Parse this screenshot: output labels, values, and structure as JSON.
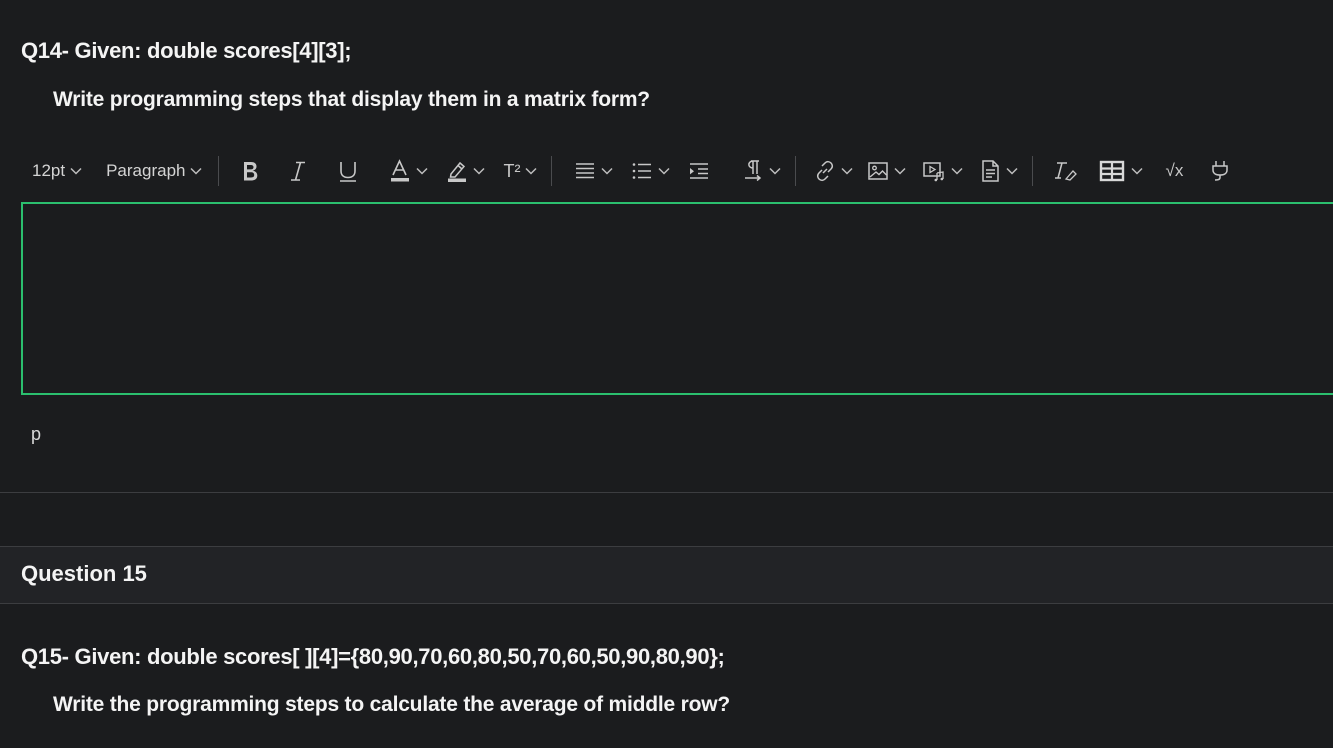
{
  "question14": {
    "title": "Q14- Given: double scores[4][3];",
    "prompt": "Write programming steps that display them in a matrix form?"
  },
  "toolbar": {
    "font_size": "12pt",
    "block_format": "Paragraph",
    "superscript_label": "T²",
    "formula_label": "√x"
  },
  "editor": {
    "content": "",
    "path": "p"
  },
  "question15": {
    "header": "Question 15",
    "title": "Q15- Given: double scores[ ][4]={80,90,70,60,80,50,70,60,50,90,80,90};",
    "prompt": "Write the programming steps to calculate the average of middle row?"
  },
  "colors": {
    "background": "#1b1c1e",
    "editor_border": "#2bbf6e",
    "header_bg": "#222326"
  }
}
